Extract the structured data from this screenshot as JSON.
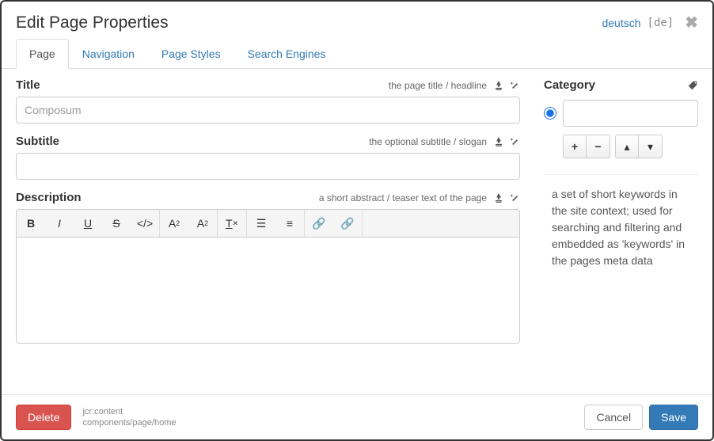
{
  "header": {
    "title": "Edit Page Properties",
    "language_label": "deutsch",
    "language_code": "[de]"
  },
  "tabs": [
    {
      "label": "Page",
      "active": true
    },
    {
      "label": "Navigation",
      "active": false
    },
    {
      "label": "Page Styles",
      "active": false
    },
    {
      "label": "Search Engines",
      "active": false
    }
  ],
  "fields": {
    "title": {
      "label": "Title",
      "hint": "the page title / headline",
      "placeholder": "Composum",
      "value": ""
    },
    "subtitle": {
      "label": "Subtitle",
      "hint": "the optional subtitle / slogan",
      "value": ""
    },
    "description": {
      "label": "Description",
      "hint": "a short abstract / teaser text of the page",
      "value": ""
    }
  },
  "category": {
    "label": "Category",
    "value": "",
    "help": "a set of short keywords in the site context; used for searching and filtering and embedded as 'keywords' in the pages meta data"
  },
  "footer": {
    "delete": "Delete",
    "cancel": "Cancel",
    "save": "Save",
    "path_name": "jcr:content",
    "path_type": "components/page/home"
  }
}
